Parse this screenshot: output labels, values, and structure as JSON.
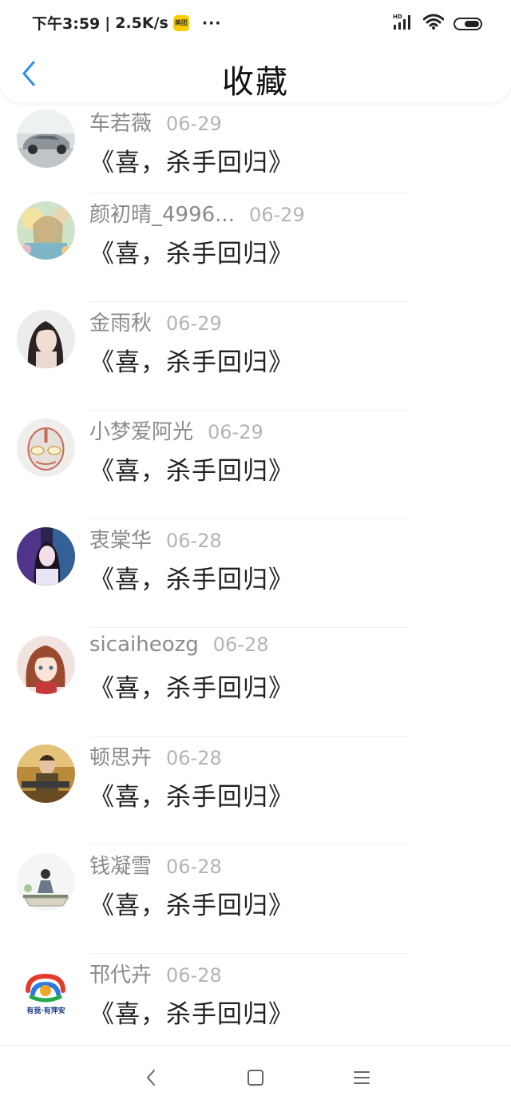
{
  "status_bar": {
    "time": "下午3:59",
    "separator": "|",
    "net_speed": "2.5K/s",
    "app_badge": "美团",
    "more": "···",
    "network_type": "HD"
  },
  "header": {
    "title": "收藏"
  },
  "colors": {
    "accent": "#2a91e8",
    "name_gray": "#8a8a8a",
    "date_gray": "#b4b4b4",
    "title_text": "#222222"
  },
  "items": [
    {
      "name": "车若薇",
      "date": "06-29",
      "title": "《喜，杀手回归》",
      "avatar": "car-photo"
    },
    {
      "name": "颜初晴_4996...",
      "date": "06-29",
      "title": "《喜，杀手回归》",
      "avatar": "anime-girl-flowers"
    },
    {
      "name": "金雨秋",
      "date": "06-29",
      "title": "《喜，杀手回归》",
      "avatar": "girl-portrait"
    },
    {
      "name": "小梦爱阿光",
      "date": "06-29",
      "title": "《喜，杀手回归》",
      "avatar": "ultraman-face"
    },
    {
      "name": "衷棠华",
      "date": "06-28",
      "title": "《喜，杀手回归》",
      "avatar": "girl-neon"
    },
    {
      "name": "sicaiheozg",
      "date": "06-28",
      "title": "《喜，杀手回归》",
      "avatar": "anime-girl-red-hair"
    },
    {
      "name": "顿思卉",
      "date": "06-28",
      "title": "《喜，杀手回归》",
      "avatar": "game-character"
    },
    {
      "name": "钱凝雪",
      "date": "06-28",
      "title": "《喜，杀手回归》",
      "avatar": "sketch-illustration"
    },
    {
      "name": "邗代卉",
      "date": "06-28",
      "title": "《喜，杀手回归》",
      "avatar": "logo-youwo-youpingan",
      "avatar_text": "有我·有萍安"
    }
  ]
}
